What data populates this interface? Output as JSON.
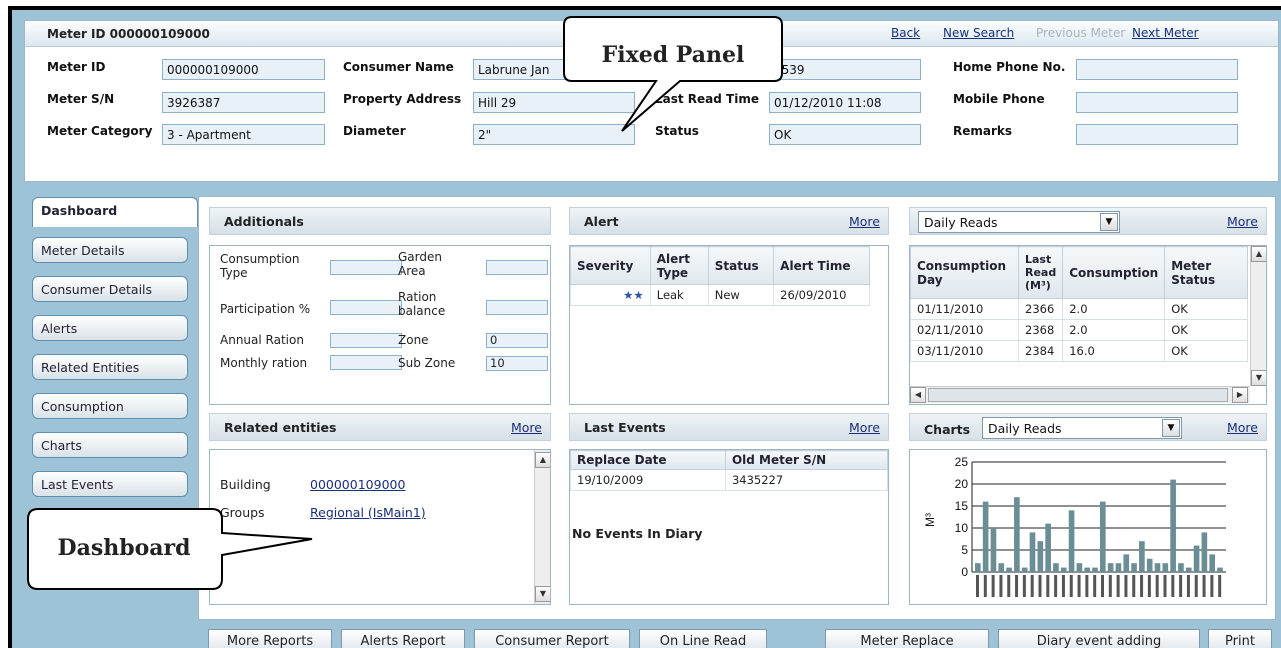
{
  "header": {
    "title": "Meter ID 000000109000",
    "nav": {
      "back": "Back",
      "new_search": "New Search",
      "previous": "Previous Meter",
      "next": "Next Meter"
    }
  },
  "fields": {
    "meter_id_label": "Meter ID",
    "meter_id": "000000109000",
    "meter_sn_label": "Meter S/N",
    "meter_sn": "3926387",
    "meter_category_label": "Meter Category",
    "meter_category": "3 - Apartment",
    "consumer_name_label": "Consumer Name",
    "consumer_name": "Labrune Jan",
    "property_address_label": "Property Address",
    "property_address": "Hill 29",
    "diameter_label": "Diameter",
    "diameter": "2\"",
    "last_read_value": "2539",
    "last_read_time_label": "Last Read Time",
    "last_read_time": "01/12/2010 11:08",
    "status_label": "Status",
    "status": "OK",
    "home_phone_label": "Home Phone No.",
    "home_phone": "",
    "mobile_phone_label": "Mobile Phone",
    "mobile_phone": "",
    "remarks_label": "Remarks",
    "remarks": ""
  },
  "callouts": {
    "fixed_panel": "Fixed Panel",
    "dashboard": "Dashboard"
  },
  "tabs": [
    "Dashboard",
    "Meter Details",
    "Consumer Details",
    "Alerts",
    "Related Entities",
    "Consumption",
    "Charts",
    "Last Events"
  ],
  "additionals": {
    "title": "Additionals",
    "consumption_type": "Consumption Type",
    "participation": "Participation %",
    "annual_ration": "Annual Ration",
    "monthly_ration": "Monthly ration",
    "garden_area": "Garden Area",
    "ration_balance": "Ration balance",
    "zone": "Zone",
    "zone_value": "0",
    "sub_zone": "Sub Zone",
    "sub_zone_value": "10"
  },
  "alert": {
    "title": "Alert",
    "more": "More",
    "headers": [
      "Severity",
      "Alert Type",
      "Status",
      "Alert Time"
    ],
    "row": {
      "severity": "★★",
      "type": "Leak",
      "status": "New",
      "time": "26/09/2010"
    }
  },
  "reads": {
    "select": "Daily Reads",
    "more": "More",
    "headers": [
      "Consumption Day",
      "Last Read (M³)",
      "Consumption",
      "Meter Status"
    ],
    "rows": [
      [
        "01/11/2010",
        "2366",
        "2.0",
        "OK"
      ],
      [
        "02/11/2010",
        "2368",
        "2.0",
        "OK"
      ],
      [
        "03/11/2010",
        "2384",
        "16.0",
        "OK"
      ]
    ]
  },
  "related": {
    "title": "Related entities",
    "more": "More",
    "building_label": "Building",
    "building": "000000109000",
    "groups_label": "Groups",
    "groups": "Regional (IsMain1)"
  },
  "events": {
    "title": "Last Events",
    "more": "More",
    "headers": [
      "Replace Date",
      "Old Meter S/N"
    ],
    "row": [
      "19/10/2009",
      "3435227"
    ],
    "empty": "No Events In Diary"
  },
  "charts": {
    "label": "Charts",
    "select": "Daily Reads",
    "more": "More"
  },
  "chart_data": {
    "type": "bar",
    "ylabel": "M³",
    "ylim": [
      0,
      25
    ],
    "yticks": [
      0,
      5,
      10,
      15,
      20,
      25
    ],
    "values": [
      2,
      16,
      10,
      2,
      1,
      17,
      1,
      9,
      7,
      11,
      2,
      1,
      14,
      2,
      1,
      1,
      16,
      2,
      2,
      4,
      2,
      7,
      3,
      2,
      2,
      21,
      2,
      1,
      6,
      9,
      4,
      1
    ]
  },
  "buttons": [
    "More Reports",
    "Alerts Report",
    "Consumer Report",
    "On Line Read",
    "Meter Replace",
    "Diary event adding",
    "Print"
  ]
}
